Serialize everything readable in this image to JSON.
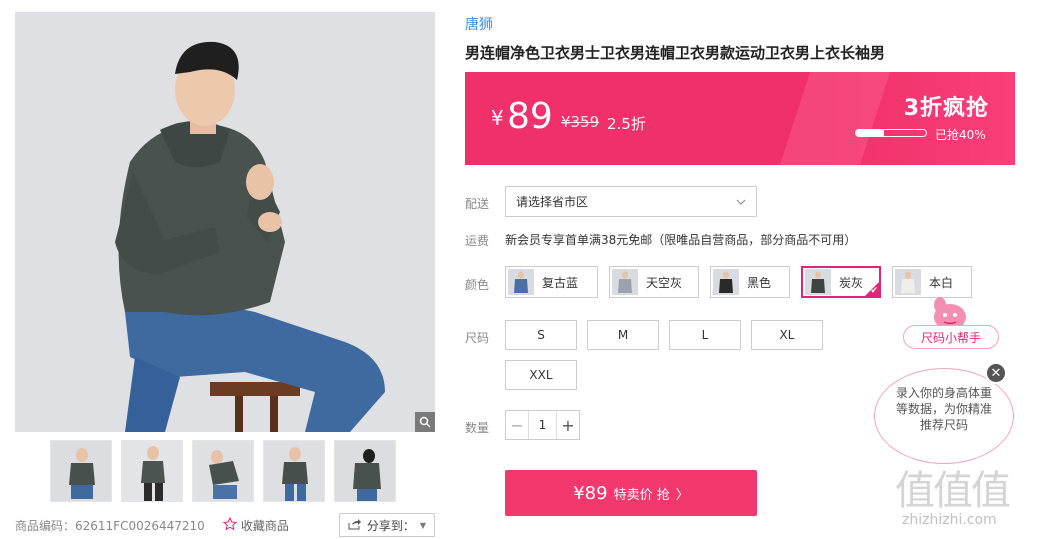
{
  "gallery": {
    "thumb_count": 5
  },
  "meta": {
    "code": "商品编码：62611FC0026447210",
    "favorite": "收藏商品",
    "share": "分享到："
  },
  "product": {
    "brand": "唐狮",
    "title": "男连帽净色卫衣男士卫衣男连帽卫衣男款运动卫衣男上衣长袖男"
  },
  "price_banner": {
    "currency": "¥",
    "price": "89",
    "original": "¥359",
    "discount": "2.5折",
    "flash_label": "3折疯抢",
    "sold_progress": 0.4,
    "sold_text": "已抢40%"
  },
  "labels": {
    "delivery": "配送",
    "shipping": "运费",
    "color": "颜色",
    "size": "尺码",
    "quantity": "数量"
  },
  "delivery": {
    "placeholder": "请选择省市区"
  },
  "shipping": {
    "text": "新会员专享首单满38元免邮（限唯品自营商品，部分商品不可用）"
  },
  "colors": [
    {
      "label": "复古蓝",
      "selected": false,
      "color": "#4a6fa5"
    },
    {
      "label": "天空灰",
      "selected": false,
      "color": "#9aa3ad"
    },
    {
      "label": "黑色",
      "selected": false,
      "color": "#2a2a2a"
    },
    {
      "label": "炭灰",
      "selected": true,
      "color": "#3e4444"
    },
    {
      "label": "本白",
      "selected": false,
      "color": "#eeeeea"
    }
  ],
  "sizes": [
    "S",
    "M",
    "L",
    "XL",
    "XXL"
  ],
  "quantity": {
    "minus": "−",
    "value": "1",
    "plus": "+"
  },
  "buy_button": {
    "price": "¥89",
    "label": "特卖价 抢",
    "arrow": "〉"
  },
  "size_helper": {
    "button": "尺码小帮手",
    "bubble": "录入你的身高体重等数据，为你精准推荐尺码",
    "close": "✕"
  },
  "watermark": {
    "logo": "值值值",
    "url": "zhizhizhi.com"
  },
  "colors_theme": {
    "accent": "#f0306a",
    "brand_link": "#3a8ee6",
    "selected_border": "#e0257a"
  }
}
